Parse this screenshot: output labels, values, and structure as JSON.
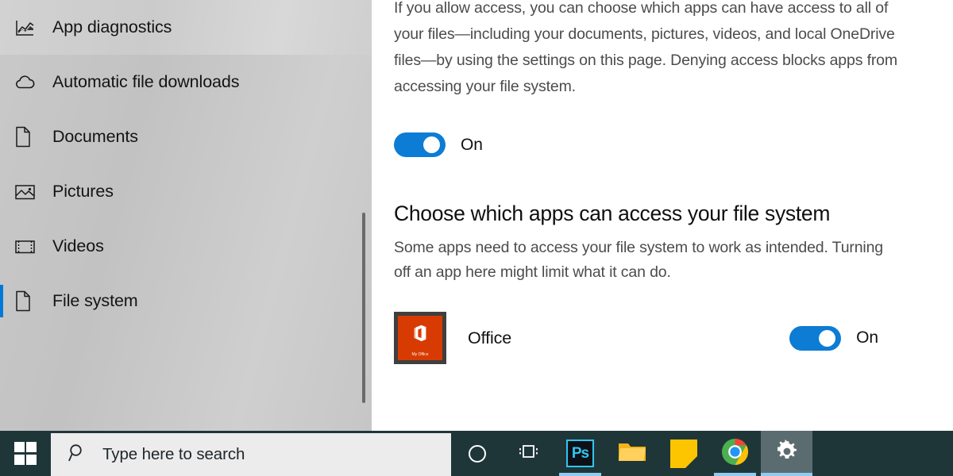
{
  "sidebar": {
    "items": [
      {
        "label": "App diagnostics",
        "icon": "chart-icon",
        "state": "hovered"
      },
      {
        "label": "Automatic file downloads",
        "icon": "cloud-icon",
        "state": "normal"
      },
      {
        "label": "Documents",
        "icon": "document-icon",
        "state": "normal"
      },
      {
        "label": "Pictures",
        "icon": "picture-icon",
        "state": "normal"
      },
      {
        "label": "Videos",
        "icon": "video-icon",
        "state": "normal"
      },
      {
        "label": "File system",
        "icon": "document-icon",
        "state": "selected"
      }
    ],
    "accent_color": "#0078d7",
    "scrollbar_visible": true
  },
  "content": {
    "intro_paragraph": "If you allow access, you can choose which apps can have access to all of your files—including your documents, pictures, videos, and local OneDrive files—by using the settings on this page. Denying access blocks apps from accessing your file system.",
    "main_toggle": {
      "label": "On",
      "state": "on",
      "color": "#0c7cd5"
    },
    "section_heading": "Choose which apps can access your file system",
    "section_subtext": "Some apps need to access your file system to work as intended. Turning off an app here might limit what it can do.",
    "apps": [
      {
        "name": "Office",
        "icon": "office-tile-icon",
        "tile_caption": "My Office",
        "tile_color": "#d83b01",
        "toggle_label": "On",
        "toggle_state": "on"
      }
    ]
  },
  "taskbar": {
    "background_color": "#1f3639",
    "start": {
      "icon": "windows-logo-icon",
      "label": "Start"
    },
    "search": {
      "icon": "search-icon",
      "placeholder": "Type here to search",
      "value": ""
    },
    "items": [
      {
        "name": "cortana",
        "icon": "cortana-circle-icon",
        "running": false,
        "active": false
      },
      {
        "name": "task-view",
        "icon": "task-view-icon",
        "running": false,
        "active": false
      },
      {
        "name": "photoshop",
        "icon": "photoshop-icon",
        "glyph": "Ps",
        "running": true,
        "active": false
      },
      {
        "name": "file-explorer",
        "icon": "folder-icon",
        "running": false,
        "active": false
      },
      {
        "name": "sticky-notes",
        "icon": "sticky-note-icon",
        "running": false,
        "active": false
      },
      {
        "name": "chrome",
        "icon": "chrome-icon",
        "running": true,
        "active": false
      },
      {
        "name": "settings",
        "icon": "gear-icon",
        "running": true,
        "active": true
      }
    ],
    "running_indicator_color": "#8fcbf0"
  }
}
